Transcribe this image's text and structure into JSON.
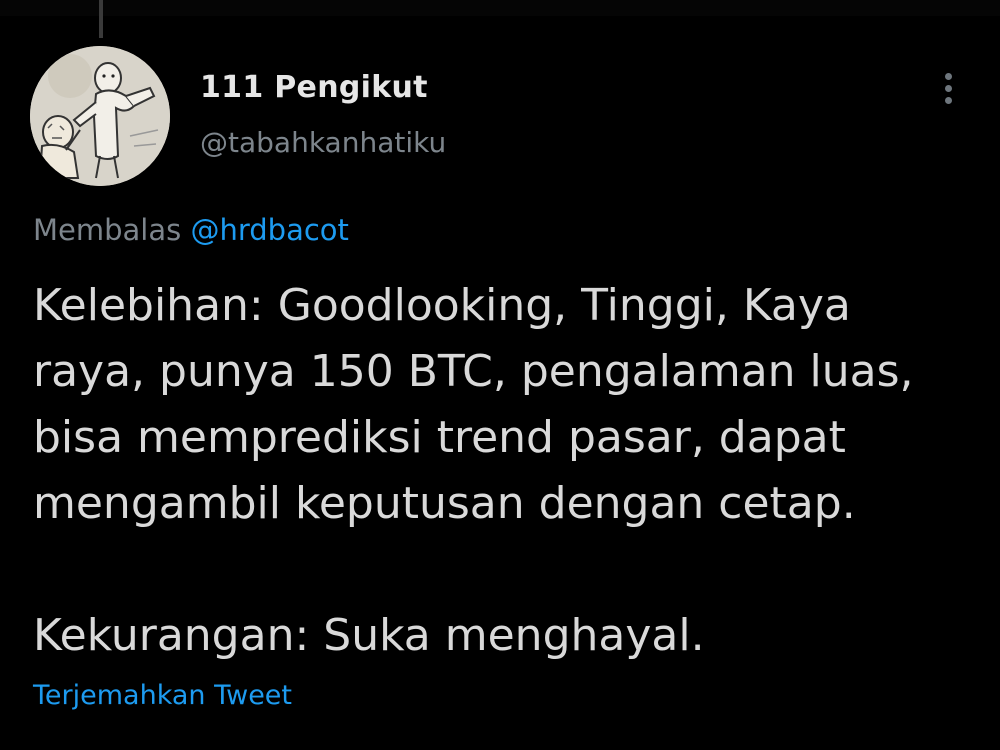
{
  "account": {
    "display_name": "111 Pengikut",
    "username": "@tabahkanhatiku",
    "avatar_icon": "cartoon-avatar-icon"
  },
  "reply": {
    "prefix": "Membalas",
    "handle": "@hrdbacot"
  },
  "tweet": {
    "paragraph_1": "Kelebihan: Goodlooking, Tinggi, Kaya\nraya, punya 150 BTC, pengalaman luas,\nbisa memprediksi trend pasar, dapat\nmengambil keputusan dengan cetap.",
    "paragraph_2": "Kekurangan: Suka menghayal."
  },
  "actions": {
    "translate_label": "Terjemahkan Tweet",
    "more_icon": "more-vertical-icon"
  },
  "colors": {
    "background": "#000000",
    "text": "#d9d9d9",
    "secondary_text": "#7d858c",
    "link": "#1d9bf0"
  }
}
